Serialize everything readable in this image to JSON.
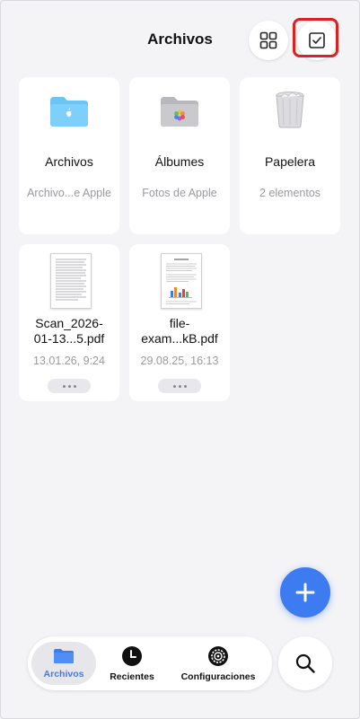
{
  "header": {
    "title": "Archivos"
  },
  "folders": [
    {
      "title": "Archivos",
      "subtitle": "Archivo...e Apple",
      "icon": "icloud-folder-icon"
    },
    {
      "title": "Álbumes",
      "subtitle": "Fotos de Apple",
      "icon": "photos-folder-icon"
    },
    {
      "title": "Papelera",
      "subtitle": "2 elementos",
      "icon": "trash-icon"
    }
  ],
  "files": [
    {
      "title_line1": "Scan_2026-",
      "title_line2": "01-13...5.pdf",
      "date": "13.01.26, 9:24"
    },
    {
      "title_line1": "file-",
      "title_line2": "exam...kB.pdf",
      "date": "29.08.25, 16:13"
    }
  ],
  "tabs": [
    {
      "label": "Archivos",
      "icon": "folder-icon",
      "active": true
    },
    {
      "label": "Recientes",
      "icon": "clock-icon",
      "active": false
    },
    {
      "label": "Configuraciones",
      "icon": "gear-icon",
      "active": false
    }
  ],
  "colors": {
    "accent": "#3d7bf0",
    "highlight": "#e02020",
    "background": "#f4f4f6"
  }
}
